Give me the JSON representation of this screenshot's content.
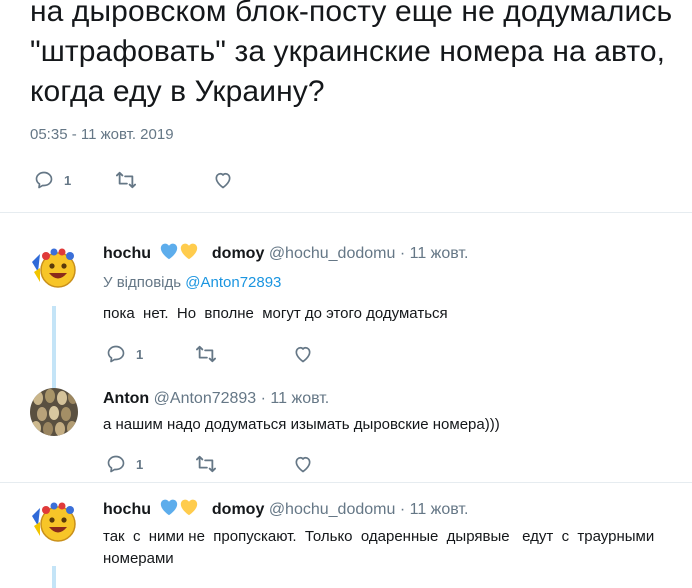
{
  "tweet": {
    "text": "на дыровском блок-посту еще не додумались \"штрафовать\" за украинские номера на авто, когда еду в Украину?",
    "timestamp": "05:35 - 11 жовт. 2019",
    "reply_count": "1",
    "retweet_count": "",
    "like_count": ""
  },
  "replies": [
    {
      "name_part1": "hochu",
      "name_part2": "domoy",
      "handle": "@hochu_dodomu",
      "time": "· 11 жовт.",
      "reply_to_label": "У відповідь",
      "reply_to_handle": "@Anton72893",
      "text": "пока  нет.  Но  вполне  могут до этого додуматься",
      "reply_count": "1"
    },
    {
      "name": "Anton",
      "handle": "@Anton72893",
      "time": "· 11 жовт.",
      "text": "а нашим надо додуматься изымать дыровские номера)))",
      "reply_count": "1"
    },
    {
      "name_part1": "hochu",
      "name_part2": "domoy",
      "handle": "@hochu_dodomu",
      "time": "· 11 жовт.",
      "text": "так  с  ними не  пропускают.  Только  одаренные  дырявые   едут  с  траурными  номерами"
    }
  ],
  "colors": {
    "muted": "#657786",
    "link": "#1b95e0",
    "thread": "#c4e4f7",
    "blue_heart": "#5dadec",
    "yellow_heart": "#ffcc4d"
  }
}
